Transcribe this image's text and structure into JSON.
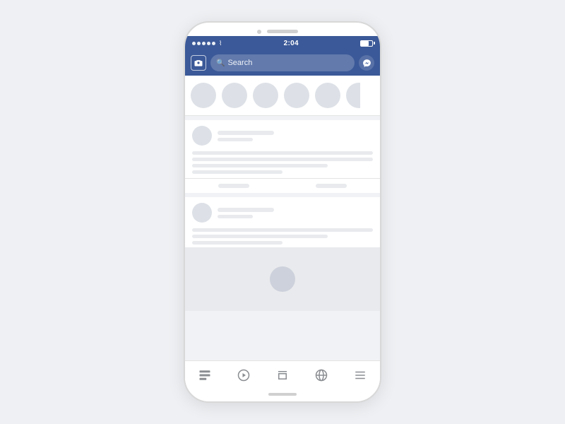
{
  "phone": {
    "status_bar": {
      "time": "2:04",
      "signal_dots": 5,
      "wifi": "wifi",
      "battery_percent": 70
    },
    "navbar": {
      "search_placeholder": "Search",
      "camera_label": "Camera",
      "messenger_label": "Messenger"
    },
    "colors": {
      "facebook_blue": "#3b5998",
      "background": "#f0f2f5",
      "placeholder_gray": "#dde1e7",
      "line_gray": "#e8eaed"
    },
    "bottom_nav": {
      "items": [
        {
          "label": "News Feed",
          "icon": "news-icon"
        },
        {
          "label": "Watch",
          "icon": "watch-icon"
        },
        {
          "label": "Marketplace",
          "icon": "marketplace-icon"
        },
        {
          "label": "Globe",
          "icon": "globe-icon"
        },
        {
          "label": "Menu",
          "icon": "menu-icon"
        }
      ]
    }
  }
}
